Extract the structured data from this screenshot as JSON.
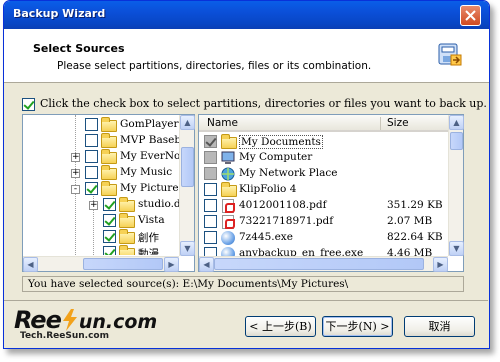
{
  "window": {
    "title": "Backup Wizard"
  },
  "header": {
    "title": "Select Sources",
    "subtitle": "Please select partitions, directories, files or its combination."
  },
  "instruction": {
    "checked": true,
    "text": "Click the check box to select partitions, directories or files you want to back up."
  },
  "tree": {
    "items": [
      {
        "label": "GomPlayer",
        "checked": false,
        "expander": ""
      },
      {
        "label": "MVP Baseba",
        "checked": false,
        "expander": ""
      },
      {
        "label": "My EverNote",
        "checked": false,
        "expander": "+"
      },
      {
        "label": "My Music",
        "checked": false,
        "expander": "+"
      },
      {
        "label": "My Pictures",
        "checked": true,
        "expander": "-"
      },
      {
        "label": "studio.da",
        "checked": true,
        "expander": "+"
      },
      {
        "label": "Vista",
        "checked": true,
        "expander": ""
      },
      {
        "label": "創作",
        "checked": true,
        "expander": ""
      },
      {
        "label": "動漫",
        "checked": true,
        "expander": ""
      }
    ]
  },
  "list": {
    "columns": {
      "name": "Name",
      "size": "Size"
    },
    "rows": [
      {
        "name": "My Documents",
        "size": "",
        "icon": "folder-open-icon",
        "checked": true,
        "gray": true
      },
      {
        "name": "My Computer",
        "size": "",
        "icon": "computer-icon",
        "checked": false,
        "gray": true
      },
      {
        "name": "My Network Place",
        "size": "",
        "icon": "network-icon",
        "checked": false,
        "gray": true
      },
      {
        "name": "KlipFolio 4",
        "size": "",
        "icon": "folder-icon",
        "checked": false,
        "gray": false
      },
      {
        "name": "4012001108.pdf",
        "size": "351.29 KB",
        "icon": "pdf-icon",
        "checked": false,
        "gray": false
      },
      {
        "name": "73221718971.pdf",
        "size": "2.07 MB",
        "icon": "pdf-icon",
        "checked": false,
        "gray": false
      },
      {
        "name": "7z445.exe",
        "size": "822.64 KB",
        "icon": "exe-icon",
        "checked": false,
        "gray": false
      },
      {
        "name": "anybackup_en_free.exe",
        "size": "4.46 MB",
        "icon": "exe-icon",
        "checked": false,
        "gray": false
      }
    ]
  },
  "status": {
    "text": "You have selected source(s): E:\\My Documents\\My Pictures\\"
  },
  "buttons": {
    "back": "< 上一步(B)",
    "next": "下一步(N) >",
    "cancel": "取消"
  },
  "watermark": {
    "brand_left": "Ree",
    "brand_right": "un.com",
    "tagline": "Tech.ReeSun.com"
  }
}
